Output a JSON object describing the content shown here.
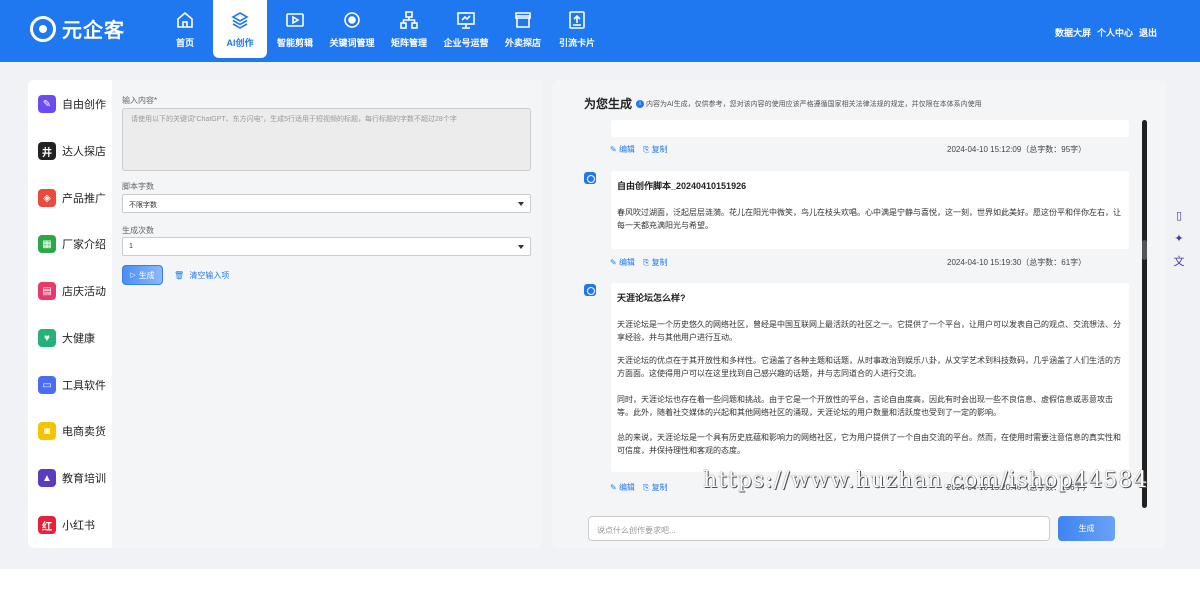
{
  "brand": {
    "name": "元企客"
  },
  "nav": {
    "items": [
      {
        "label": "首页",
        "icon": "home-icon"
      },
      {
        "label": "AI创作",
        "icon": "layers-icon"
      },
      {
        "label": "智能剪辑",
        "icon": "video-icon"
      },
      {
        "label": "关键词管理",
        "icon": "target-icon"
      },
      {
        "label": "矩阵管理",
        "icon": "hierarchy-icon"
      },
      {
        "label": "企业号运营",
        "icon": "presentation-icon"
      },
      {
        "label": "外卖探店",
        "icon": "store-icon"
      },
      {
        "label": "引流卡片",
        "icon": "upload-card-icon"
      }
    ],
    "active_index": 1
  },
  "top_right": {
    "dashboard": "数据大屏",
    "user_center": "个人中心",
    "logout": "退出"
  },
  "sidebar": {
    "items": [
      {
        "label": "自由创作",
        "color": "#6c4cf0",
        "glyph": "✎"
      },
      {
        "label": "达人探店",
        "color": "#222222",
        "glyph": "井"
      },
      {
        "label": "产品推广",
        "color": "#e84a3b",
        "glyph": "◈"
      },
      {
        "label": "厂家介绍",
        "color": "#2aa84a",
        "glyph": "▦"
      },
      {
        "label": "店庆活动",
        "color": "#e83a6a",
        "glyph": "▤"
      },
      {
        "label": "大健康",
        "color": "#23b37a",
        "glyph": "♥"
      },
      {
        "label": "工具软件",
        "color": "#4a6cf0",
        "glyph": "▭"
      },
      {
        "label": "电商卖货",
        "color": "#f5c400",
        "glyph": "◙"
      },
      {
        "label": "教育培训",
        "color": "#5a3cc0",
        "glyph": "▲"
      },
      {
        "label": "小红书",
        "color": "#e8203a",
        "glyph": "红"
      }
    ]
  },
  "form": {
    "content_label": "输入内容*",
    "content_placeholder": "请使用以下的关键词\"ChatGPT、东方闪电\"，生成5行适用于短视频的标题，每行标题的字数不超过28个字",
    "length_label": "脚本字数",
    "length_value": "不限字数",
    "count_label": "生成次数",
    "count_value": "1",
    "generate_label": "生成",
    "clear_label": "清空输入项"
  },
  "results": {
    "title": "为您生成",
    "note": "内容为AI生成，仅供参考，您对该内容的使用应该严格遵循国家相关法律法规的规定，并仅限在本体系内使用",
    "edit_label": "编辑",
    "copy_label": "复制",
    "messages": [
      {
        "meta": "2024-04-10 15:12:09（总字数：95字）"
      },
      {
        "title": "自由创作脚本_20240410151926",
        "paragraphs": [
          "春风吹过湖面，泛起层层涟漪。花儿在阳光中微笑，鸟儿在枝头欢唱。心中满是宁静与喜悦，这一刻，世界如此美好。愿这份平和伴你左右，让每一天都充满阳光与希望。"
        ],
        "meta": "2024-04-10 15:19:30（总字数：61字）"
      },
      {
        "title": "天涯论坛怎么样?",
        "paragraphs": [
          "天涯论坛是一个历史悠久的网络社区，曾经是中国互联网上最活跃的社区之一。它提供了一个平台，让用户可以发表自己的观点、交流想法、分享经验，并与其他用户进行互动。",
          "天涯论坛的优点在于其开放性和多样性。它涵盖了各种主题和话题，从时事政治到娱乐八卦，从文学艺术到科技数码，几乎涵盖了人们生活的方方面面。这使得用户可以在这里找到自己感兴趣的话题，并与志同道合的人进行交流。",
          "同时，天涯论坛也存在着一些问题和挑战。由于它是一个开放性的平台，言论自由度高，因此有时会出现一些不良信息、虚假信息或恶意攻击等。此外，随着社交媒体的兴起和其他网络社区的涌现，天涯论坛的用户数量和活跃度也受到了一定的影响。",
          "总的来说，天涯论坛是一个具有历史底蕴和影响力的网络社区，它为用户提供了一个自由交流的平台。然而，在使用时需要注意信息的真实性和可信度，并保持理性和客观的态度。"
        ],
        "meta": "2024-04-10 15:20:46（总字数：196字）"
      }
    ],
    "chat_placeholder": "说点什么创作要求吧...",
    "send_label": "生成"
  },
  "watermark": "https://www.huzhan.com/ishop44584"
}
